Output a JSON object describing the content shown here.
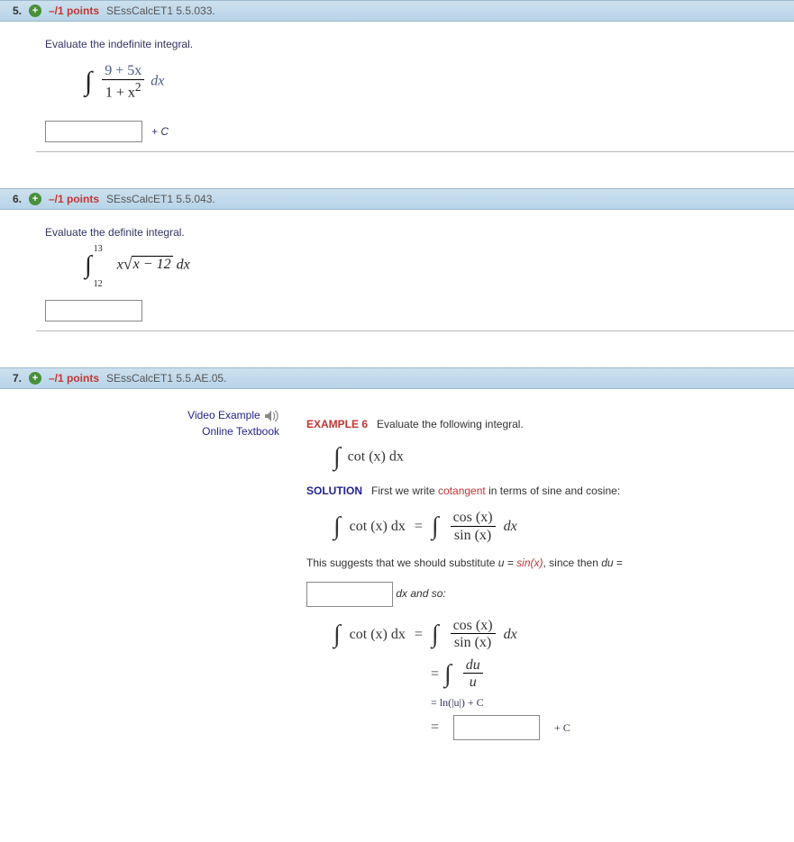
{
  "questions": [
    {
      "num": "5.",
      "points": "–/1 points",
      "ref": "SEssCalcET1 5.5.033.",
      "prompt": "Evaluate the indefinite integral.",
      "plusC": "+ C"
    },
    {
      "num": "6.",
      "points": "–/1 points",
      "ref": "SEssCalcET1 5.5.043.",
      "prompt": "Evaluate the definite integral."
    },
    {
      "num": "7.",
      "points": "–/1 points",
      "ref": "SEssCalcET1 5.5.AE.05.",
      "links": {
        "video": "Video Example",
        "textbook": "Online Textbook"
      },
      "example": {
        "label": "EXAMPLE 6",
        "prompt": "Evaluate the following integral."
      },
      "solution": {
        "label": "SOLUTION",
        "line1_a": "First we write ",
        "line1_hl": "cotangent",
        "line1_b": " in terms of sine and cosine:",
        "line2_a": "This suggests that we should substitute ",
        "line2_u": "u",
        "line2_eq": " = ",
        "line2_sinx": "sin(",
        "line2_x": "x",
        "line2_close": ")",
        "line2_b": ", since then ",
        "line2_du": "du",
        "line2_c": " =",
        "dx_and_so": " dx and so:",
        "ln_line": "= ln(|u|) + C",
        "final_plusC": "+ C",
        "eq_sign": "="
      }
    }
  ],
  "math": {
    "q5": {
      "num": "9 + 5x",
      "den_a": "1 + x",
      "den_sup": "2",
      "dx": "dx"
    },
    "q6": {
      "upper": "13",
      "lower": "12",
      "x": "x",
      "rad": "x − 12",
      "dx": " dx"
    },
    "q7": {
      "cot": "cot (x) dx",
      "cos": "cos (x)",
      "sin": "sin (x)",
      "dx": "dx",
      "du": "du",
      "u": "u"
    }
  }
}
